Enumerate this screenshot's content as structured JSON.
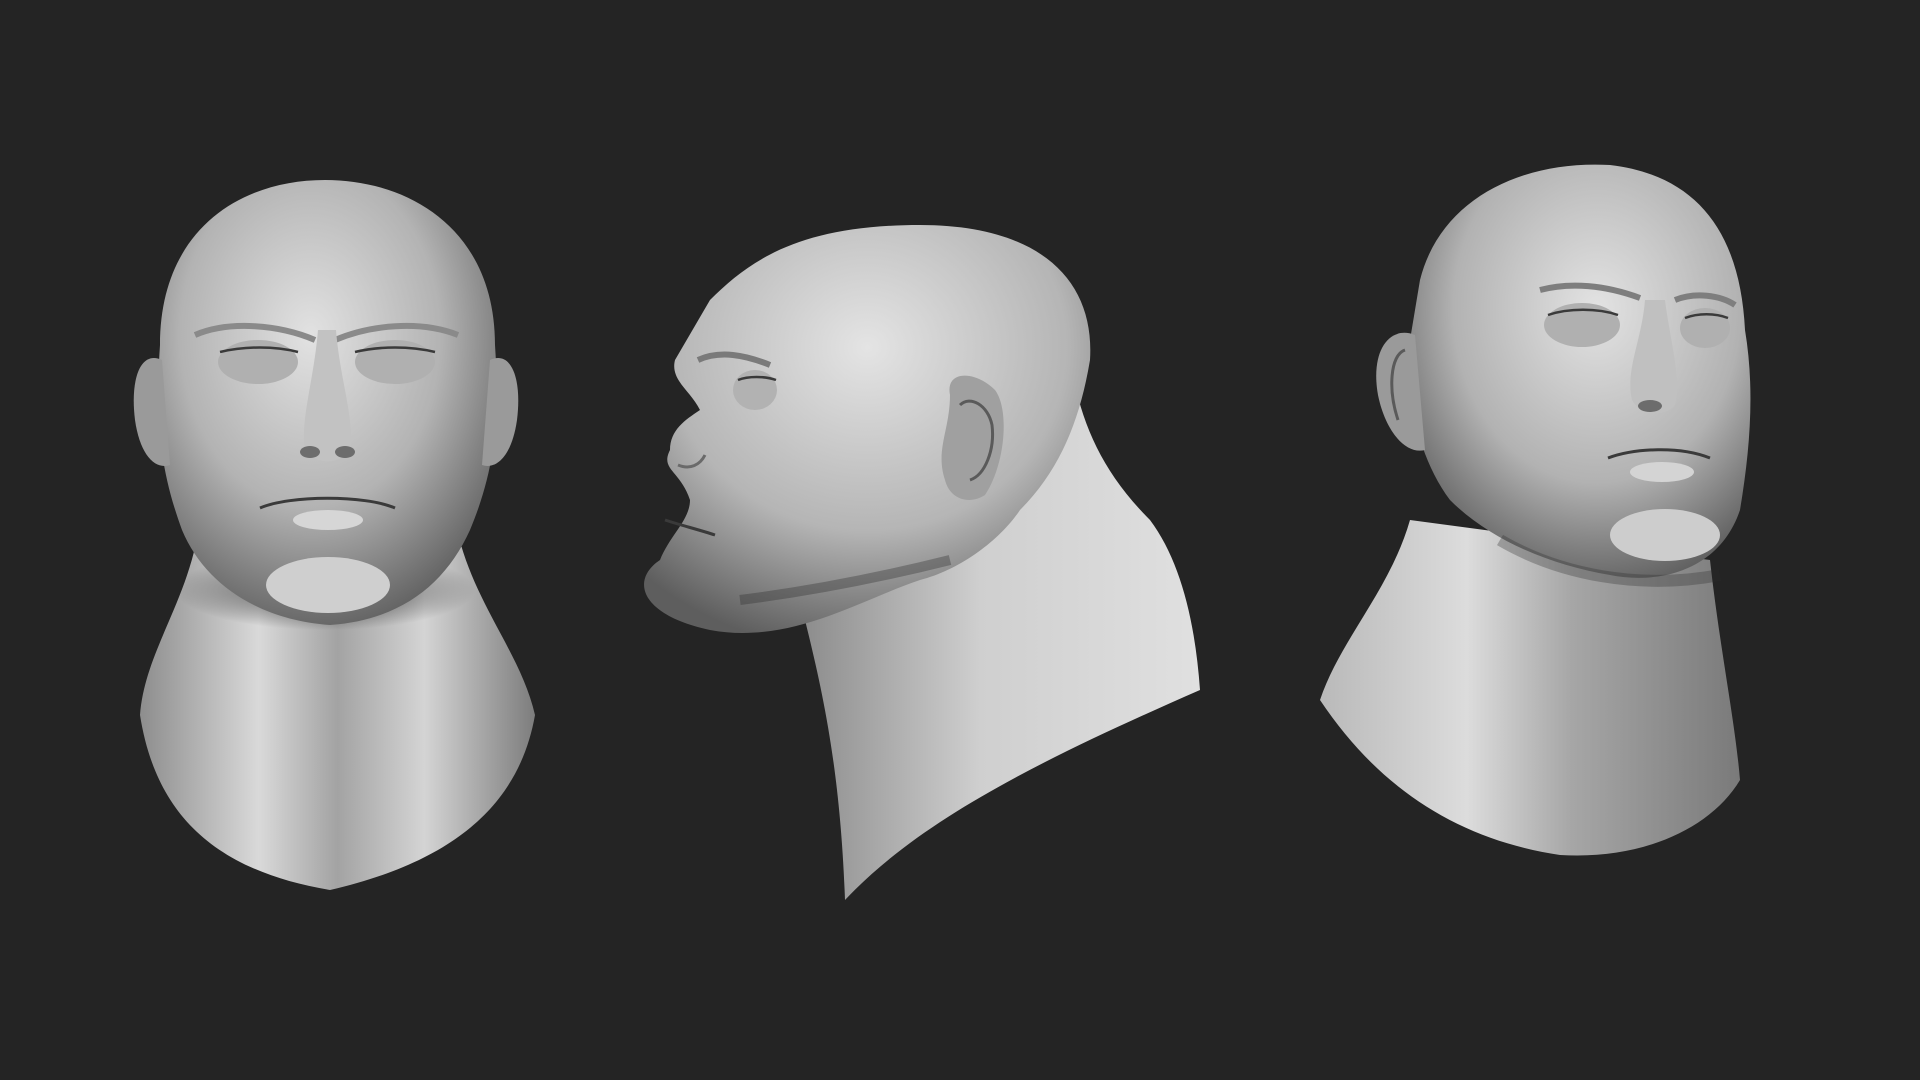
{
  "scene": {
    "background_color": "#242424",
    "clay_color": "#c8c8c8",
    "views": [
      {
        "id": "front",
        "icon": "front-head-sculpt"
      },
      {
        "id": "side",
        "icon": "profile-head-sculpt"
      },
      {
        "id": "three-quarter",
        "icon": "three-quarter-head-sculpt"
      }
    ]
  }
}
